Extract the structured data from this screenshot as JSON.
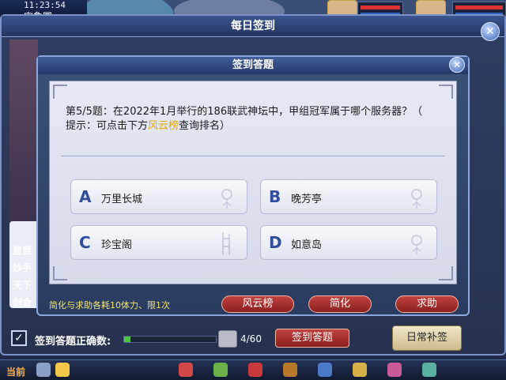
{
  "hud": {
    "clock": "11:23:54",
    "location": "宝象国"
  },
  "outer_dialog": {
    "title": "每日签到",
    "close_icon": "close-icon",
    "correct_count_label": "签到答题正确数:",
    "correct_count": "4/60",
    "progress_fraction": 0.0667,
    "checkbox_checked": true,
    "checkin_button": "签到答题",
    "daily_makeup_button": "日常补签",
    "side_text": [
      "皇宫",
      "妙手",
      "天下",
      "剑会"
    ]
  },
  "quiz_dialog": {
    "title": "签到答题",
    "close_icon": "close-icon",
    "question_line1": "第5/5题：在2022年1月举行的186联武神坛中，甲组冠军属于哪个服务器？（",
    "hint_prefix": "提示：可点击下方",
    "hint_highlight": "风云榜",
    "hint_suffix": "查询排名）",
    "options": [
      {
        "letter": "A",
        "text": "万里长城"
      },
      {
        "letter": "B",
        "text": "晚芳亭"
      },
      {
        "letter": "C",
        "text": "珍宝阁"
      },
      {
        "letter": "D",
        "text": "如意岛"
      }
    ],
    "notice": "简化与求助各耗10体力、限1次",
    "buttons": {
      "ranking": "风云榜",
      "simplify": "简化",
      "help": "求助"
    }
  },
  "taskbar": {
    "current_label": "当前"
  },
  "colors": {
    "highlight": "#e6a800",
    "notice": "#f2e46a",
    "option_letter": "#2f4f9e",
    "red_button": "#a33230"
  }
}
